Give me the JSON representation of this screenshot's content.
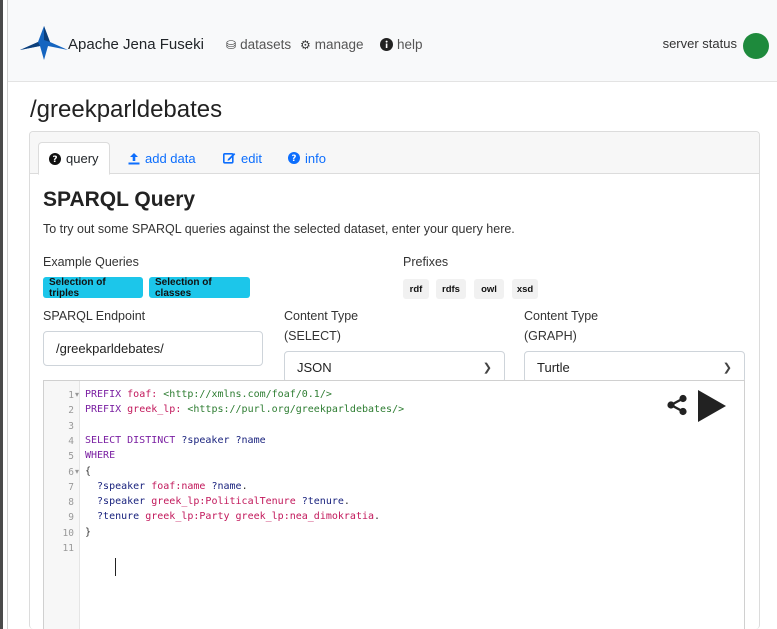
{
  "app": {
    "brand": "Apache Jena Fuseki",
    "server_status": "server status",
    "status_color": "#1e8a3c"
  },
  "nav": [
    {
      "icon": "database-icon",
      "label": "datasets"
    },
    {
      "icon": "gears-icon",
      "label": "manage"
    },
    {
      "icon": "info-circle-icon",
      "label": "help"
    }
  ],
  "dataset": {
    "title": "/greekparldebates"
  },
  "tabs": [
    {
      "icon": "question-circle-icon",
      "label": "query",
      "active": true
    },
    {
      "icon": "upload-icon",
      "label": "add data",
      "active": false
    },
    {
      "icon": "edit-icon",
      "label": "edit",
      "active": false
    },
    {
      "icon": "info-icon",
      "label": "info",
      "active": false
    }
  ],
  "query": {
    "title": "SPARQL Query",
    "intro": "To try out some SPARQL queries against the selected dataset, enter your query here.",
    "example_label": "Example Queries",
    "examples": [
      "Selection of triples",
      "Selection of classes"
    ],
    "prefixes_label": "Prefixes",
    "prefixes": [
      "rdf",
      "rdfs",
      "owl",
      "xsd"
    ],
    "endpoint_label": "SPARQL Endpoint",
    "endpoint_value": "/greekparldebates/",
    "ct_select_label_1": "Content Type",
    "ct_select_label_2": "(SELECT)",
    "ct_select_value": "JSON",
    "ct_graph_label_1": "Content Type",
    "ct_graph_label_2": "(GRAPH)",
    "ct_graph_value": "Turtle",
    "accent_color": "#1cc6ea"
  },
  "editor": {
    "line_numbers": [
      "1",
      "2",
      "3",
      "4",
      "5",
      "6",
      "7",
      "8",
      "9",
      "10",
      "11"
    ],
    "lines": [
      [
        [
          "kw",
          "PREFIX "
        ],
        [
          "pfx",
          "foaf: "
        ],
        [
          "iri",
          "<http://xmlns.com/foaf/0.1/>"
        ]
      ],
      [
        [
          "kw",
          "PREFIX "
        ],
        [
          "pfx",
          "greek_lp: "
        ],
        [
          "iri",
          "<https://purl.org/greekparldebates/>"
        ]
      ],
      [],
      [
        [
          "kw",
          "SELECT DISTINCT "
        ],
        [
          "var",
          "?speaker ?name"
        ]
      ],
      [
        [
          "kw",
          "WHERE"
        ]
      ],
      [
        [
          "pl",
          "{"
        ]
      ],
      [
        [
          "var",
          "  ?speaker "
        ],
        [
          "pfx",
          "foaf:name "
        ],
        [
          "var",
          "?name"
        ],
        [
          "pl",
          "."
        ]
      ],
      [
        [
          "var",
          "  ?speaker "
        ],
        [
          "pfx",
          "greek_lp:PoliticalTenure "
        ],
        [
          "var",
          "?tenure"
        ],
        [
          "pl",
          "."
        ]
      ],
      [
        [
          "var",
          "  ?tenure "
        ],
        [
          "pfx",
          "greek_lp:Party "
        ],
        [
          "pfx",
          "greek_lp:nea_dimokratia"
        ],
        [
          "pl",
          "."
        ]
      ],
      [
        [
          "pl",
          "}"
        ]
      ],
      []
    ]
  }
}
